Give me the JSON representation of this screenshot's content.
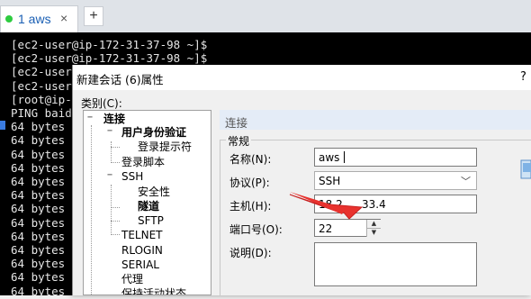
{
  "tabs": [
    {
      "label": "1 aws",
      "active": true,
      "status_color": "#2ecc40",
      "close": "×"
    }
  ],
  "new_tab": "+",
  "terminal": {
    "lines": [
      "[ec2-user@ip-172-31-37-98 ~]$",
      "[ec2-user@ip-172-31-37-98 ~]$",
      "[ec2-user@ip-1",
      "[ec2-user@ip-1",
      "[root@ip-1",
      "PING baidu",
      "64 bytes f",
      "64 bytes f",
      "64 bytes f",
      "64 bytes f",
      "64 bytes f",
      "64 bytes f",
      "64 bytes f",
      "64 bytes f",
      "64 bytes f",
      "64 bytes f",
      "64 bytes f",
      "64 bytes f",
      "64 bytes f"
    ]
  },
  "dialog": {
    "title": "新建会话 (6)属性",
    "help": "?",
    "category_label": "类别(C):",
    "tree": [
      {
        "label": "连接",
        "bold": true,
        "toggle": "−"
      },
      {
        "label": "用户身份验证",
        "bold": true,
        "toggle": "−"
      },
      {
        "label": "登录提示符",
        "bold": false
      },
      {
        "label": "登录脚本",
        "bold": false
      },
      {
        "label": "SSH",
        "bold": false,
        "toggle": "−"
      },
      {
        "label": "安全性",
        "bold": false
      },
      {
        "label": "隧道",
        "bold": true
      },
      {
        "label": "SFTP",
        "bold": false
      },
      {
        "label": "TELNET",
        "bold": false
      },
      {
        "label": "RLOGIN",
        "bold": false
      },
      {
        "label": "SERIAL",
        "bold": false
      },
      {
        "label": "代理",
        "bold": false
      },
      {
        "label": "保持活动状态",
        "bold": false
      }
    ],
    "panel_header": "连接",
    "group_title": "常规",
    "fields": {
      "name": {
        "label": "名称(N):",
        "value": "aws"
      },
      "protocol": {
        "label": "协议(P):",
        "value": "SSH"
      },
      "host": {
        "label": "主机(H):",
        "value": "18.2",
        "value_tail": "33.4"
      },
      "port": {
        "label": "端口号(O):",
        "value": "22"
      },
      "description": {
        "label": "说明(D):",
        "value": ""
      }
    }
  },
  "colors": {
    "terminal_bg": "#000000",
    "terminal_fg": "#e6e6e6",
    "annotation_arrow": "#e8322e",
    "panel_header_bg": "#e4ecf7"
  }
}
